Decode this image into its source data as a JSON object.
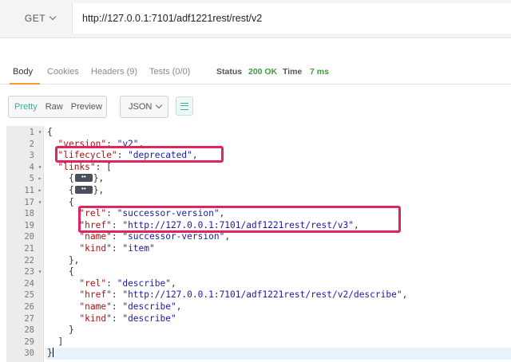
{
  "request": {
    "method": "GET",
    "url": "http://127.0.0.1:7101/adf1221rest/rest/v2"
  },
  "response_tabs": [
    {
      "label": "Body",
      "active": true
    },
    {
      "label": "Cookies",
      "active": false
    },
    {
      "label": "Headers (9)",
      "active": false
    },
    {
      "label": "Tests (0/0)",
      "active": false
    }
  ],
  "status": {
    "label": "Status",
    "value": "200 OK",
    "time_label": "Time",
    "time_value": "7 ms"
  },
  "view_modes": [
    "Pretty",
    "Raw",
    "Preview"
  ],
  "active_view_mode": "Pretty",
  "format": "JSON",
  "colors": {
    "accent": "#3cae9e",
    "highlight": "#e0245e",
    "tab_underline": "#f0a030",
    "status_ok": "#3f9b3f"
  },
  "lines": [
    {
      "n": "1",
      "fold": "▾",
      "tokens": [
        [
          "p",
          "{"
        ]
      ]
    },
    {
      "n": "2",
      "fold": "",
      "tokens": [
        [
          "p",
          "  "
        ],
        [
          "k",
          "\"version\""
        ],
        [
          "p",
          ": "
        ],
        [
          "s",
          "\"v2\""
        ],
        [
          "p",
          ","
        ]
      ]
    },
    {
      "n": "3",
      "fold": "",
      "tokens": [
        [
          "p",
          "  "
        ],
        [
          "k",
          "\"lifecycle\""
        ],
        [
          "p",
          ": "
        ],
        [
          "s",
          "\"deprecated\""
        ],
        [
          "p",
          ","
        ]
      ]
    },
    {
      "n": "4",
      "fold": "▾",
      "tokens": [
        [
          "p",
          "  "
        ],
        [
          "k",
          "\"links\""
        ],
        [
          "p",
          ": ["
        ]
      ]
    },
    {
      "n": "5",
      "fold": "▸",
      "tokens": [
        [
          "p",
          "    {"
        ],
        [
          "chip",
          ""
        ],
        [
          "p",
          "},"
        ]
      ]
    },
    {
      "n": "11",
      "fold": "▸",
      "tokens": [
        [
          "p",
          "    {"
        ],
        [
          "chip",
          ""
        ],
        [
          "p",
          "},"
        ]
      ]
    },
    {
      "n": "17",
      "fold": "▾",
      "tokens": [
        [
          "p",
          "    {"
        ]
      ]
    },
    {
      "n": "18",
      "fold": "",
      "tokens": [
        [
          "p",
          "      "
        ],
        [
          "k",
          "\"rel\""
        ],
        [
          "p",
          ": "
        ],
        [
          "s",
          "\"successor-version\""
        ],
        [
          "p",
          ","
        ]
      ]
    },
    {
      "n": "19",
      "fold": "",
      "tokens": [
        [
          "p",
          "      "
        ],
        [
          "k",
          "\"href\""
        ],
        [
          "p",
          ": "
        ],
        [
          "s",
          "\"http://127.0.0.1:7101/adf1221rest/rest/v3\""
        ],
        [
          "p",
          ","
        ]
      ]
    },
    {
      "n": "20",
      "fold": "",
      "tokens": [
        [
          "p",
          "      "
        ],
        [
          "k",
          "\"name\""
        ],
        [
          "p",
          ": "
        ],
        [
          "s",
          "\"successor-version\""
        ],
        [
          "p",
          ","
        ]
      ]
    },
    {
      "n": "21",
      "fold": "",
      "tokens": [
        [
          "p",
          "      "
        ],
        [
          "k",
          "\"kind\""
        ],
        [
          "p",
          ": "
        ],
        [
          "s",
          "\"item\""
        ]
      ]
    },
    {
      "n": "22",
      "fold": "",
      "tokens": [
        [
          "p",
          "    },"
        ]
      ]
    },
    {
      "n": "23",
      "fold": "▾",
      "tokens": [
        [
          "p",
          "    {"
        ]
      ]
    },
    {
      "n": "24",
      "fold": "",
      "tokens": [
        [
          "p",
          "      "
        ],
        [
          "k",
          "\"rel\""
        ],
        [
          "p",
          ": "
        ],
        [
          "s",
          "\"describe\""
        ],
        [
          "p",
          ","
        ]
      ]
    },
    {
      "n": "25",
      "fold": "",
      "tokens": [
        [
          "p",
          "      "
        ],
        [
          "k",
          "\"href\""
        ],
        [
          "p",
          ": "
        ],
        [
          "s",
          "\"http://127.0.0.1:7101/adf1221rest/rest/v2/describe\""
        ],
        [
          "p",
          ","
        ]
      ]
    },
    {
      "n": "26",
      "fold": "",
      "tokens": [
        [
          "p",
          "      "
        ],
        [
          "k",
          "\"name\""
        ],
        [
          "p",
          ": "
        ],
        [
          "s",
          "\"describe\""
        ],
        [
          "p",
          ","
        ]
      ]
    },
    {
      "n": "27",
      "fold": "",
      "tokens": [
        [
          "p",
          "      "
        ],
        [
          "k",
          "\"kind\""
        ],
        [
          "p",
          ": "
        ],
        [
          "s",
          "\"describe\""
        ]
      ]
    },
    {
      "n": "28",
      "fold": "",
      "tokens": [
        [
          "p",
          "    }"
        ]
      ]
    },
    {
      "n": "29",
      "fold": "",
      "tokens": [
        [
          "p",
          "  ]"
        ]
      ]
    },
    {
      "n": "30",
      "fold": "",
      "tokens": [
        [
          "p",
          "}"
        ]
      ]
    }
  ],
  "current_line": "30"
}
